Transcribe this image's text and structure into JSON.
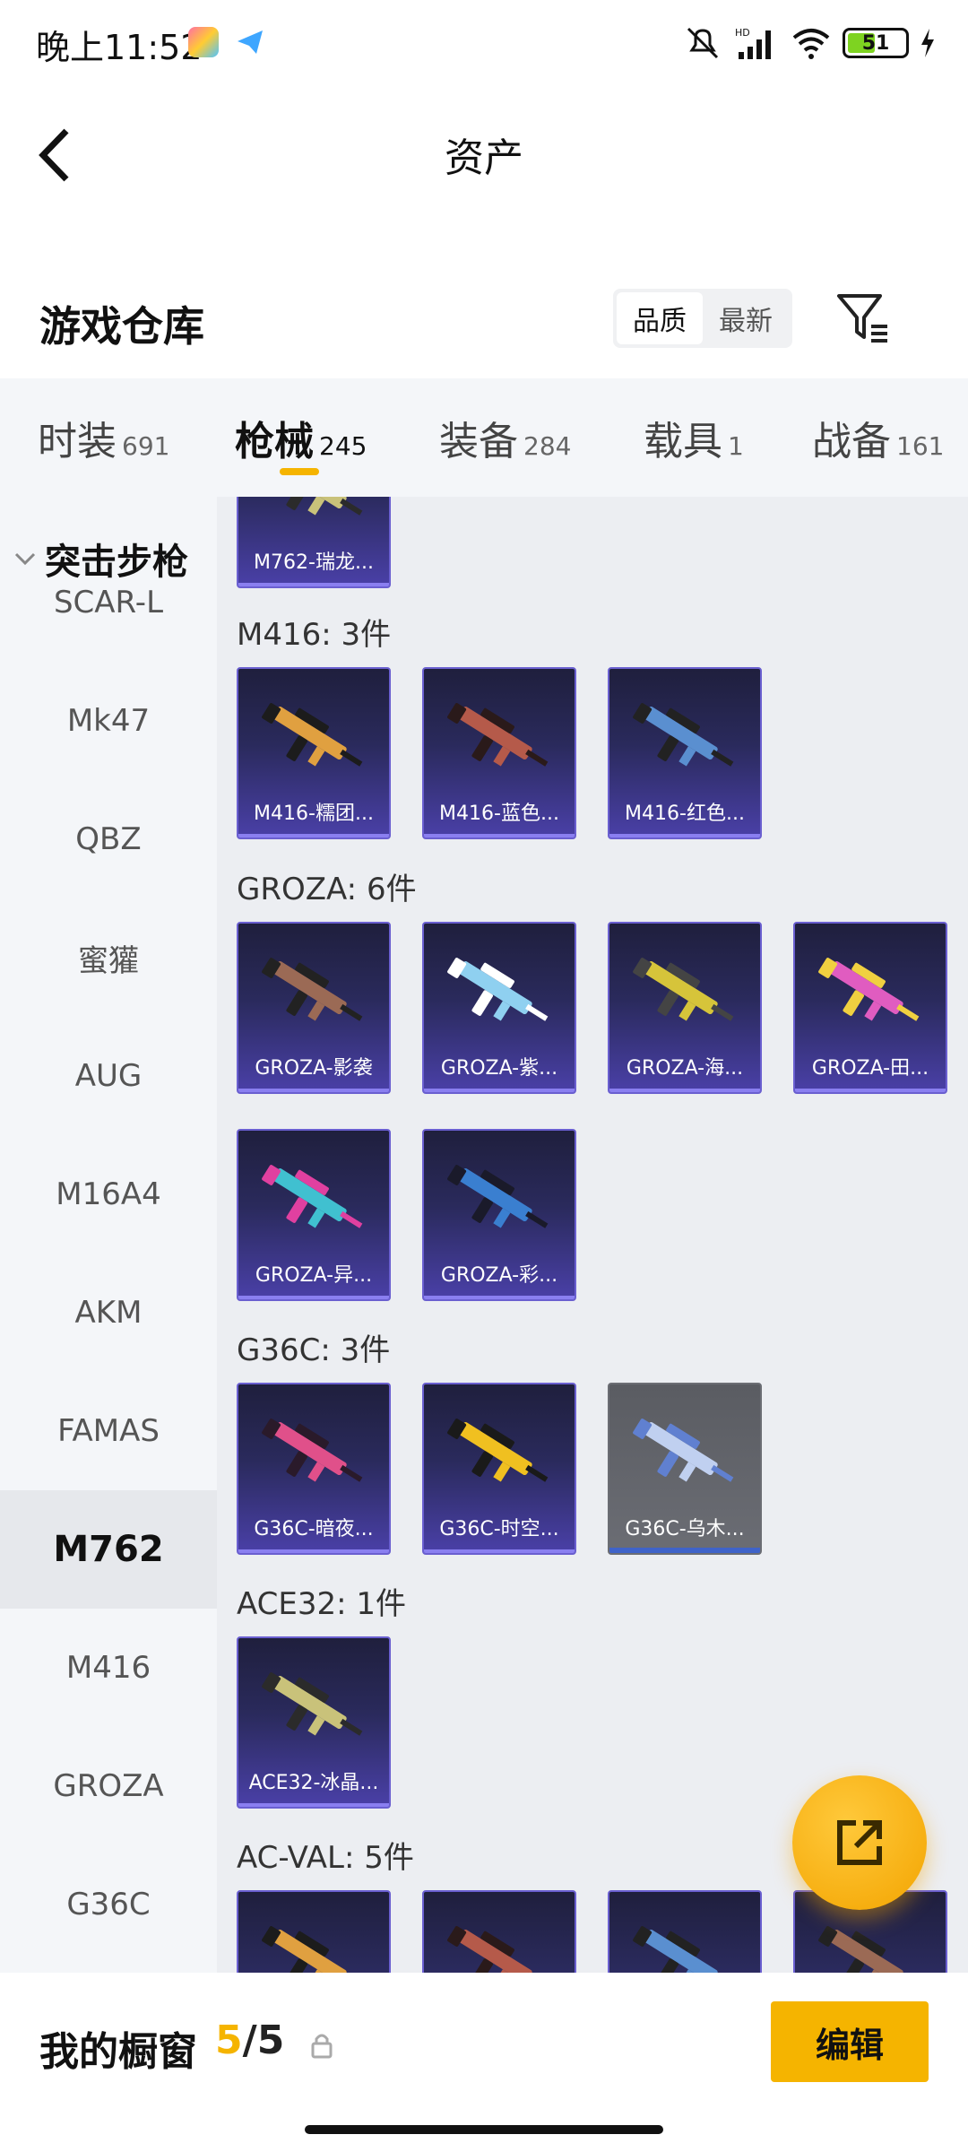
{
  "status": {
    "time": "晚上11:52",
    "battery": "51"
  },
  "header": {
    "title": "资产"
  },
  "section": {
    "title": "游戏仓库",
    "sort": [
      "品质",
      "最新"
    ]
  },
  "tabs": [
    {
      "label": "时装",
      "count": "691"
    },
    {
      "label": "枪械",
      "count": "245"
    },
    {
      "label": "装备",
      "count": "284"
    },
    {
      "label": "载具",
      "count": "1"
    },
    {
      "label": "战备",
      "count": "161"
    }
  ],
  "sidebar": {
    "group": "突击步枪",
    "items": [
      "SCAR-L",
      "Mk47",
      "QBZ",
      "蜜獾",
      "AUG",
      "M16A4",
      "AKM",
      "FAMAS",
      "M762",
      "M416",
      "GROZA",
      "G36C"
    ],
    "active_index": 8
  },
  "groups": [
    {
      "title": "",
      "cards": [
        "M762-瑞龙..."
      ]
    },
    {
      "title": "M416: 3件",
      "cards": [
        "M416-糯团...",
        "M416-蓝色...",
        "M416-红色..."
      ]
    },
    {
      "title": "GROZA: 6件",
      "cards": [
        "GROZA-影袭",
        "GROZA-紫...",
        "GROZA-海...",
        "GROZA-田...",
        "GROZA-异...",
        "GROZA-彩..."
      ]
    },
    {
      "title": "G36C: 3件",
      "cards": [
        "G36C-暗夜...",
        "G36C-时空...",
        "G36C-乌木..."
      ]
    },
    {
      "title": "ACE32: 1件",
      "cards": [
        "ACE32-冰晶..."
      ]
    },
    {
      "title": "AC-VAL: 5件",
      "cards": [
        "",
        "",
        "",
        ""
      ]
    }
  ],
  "bottom": {
    "showcase_label": "我的橱窗",
    "current": "5",
    "total": "/5",
    "edit": "编辑"
  },
  "colors": {
    "accent": "#f5b400",
    "card_top": "#1f1f3d",
    "card_bottom": "#4a40a8"
  },
  "icons": [
    "back-icon",
    "filter-icon",
    "share-icon",
    "lock-icon",
    "chevron-down-icon",
    "gun-icon"
  ]
}
